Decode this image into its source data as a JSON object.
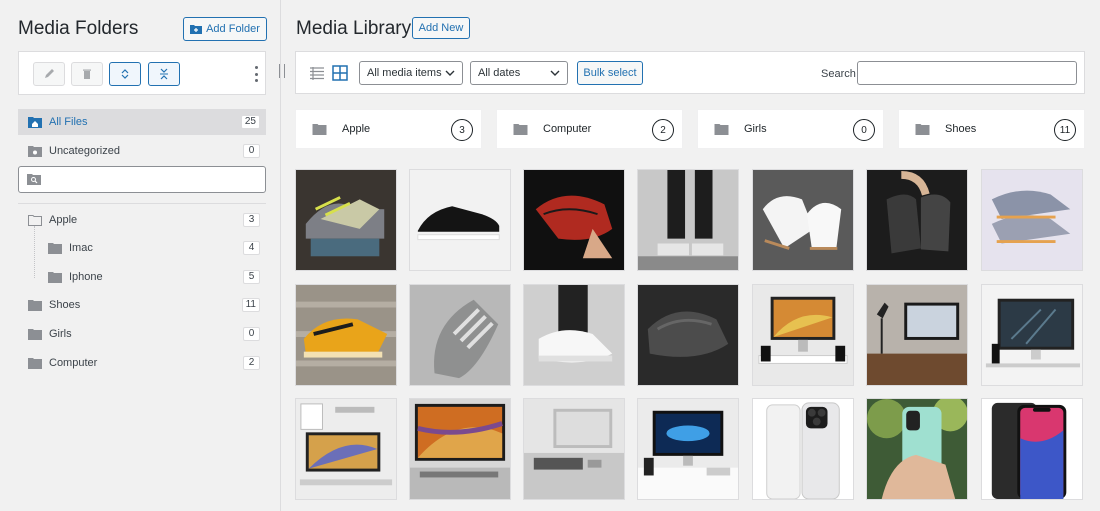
{
  "sidebar": {
    "title": "Media Folders",
    "add_folder_label": "Add Folder",
    "system_folders": [
      {
        "label": "All Files",
        "count": "25"
      },
      {
        "label": "Uncategorized",
        "count": "0"
      }
    ],
    "search": {
      "placeholder": ""
    },
    "tree": [
      {
        "label": "Apple",
        "count": "3"
      },
      {
        "label": "Imac",
        "count": "4"
      },
      {
        "label": "Iphone",
        "count": "5"
      },
      {
        "label": "Shoes",
        "count": "11"
      },
      {
        "label": "Girls",
        "count": "0"
      },
      {
        "label": "Computer",
        "count": "2"
      }
    ]
  },
  "main": {
    "title": "Media Library",
    "add_new_label": "Add New",
    "filters": {
      "media_type": "All media items",
      "dates": "All dates",
      "bulk_label": "Bulk select",
      "search_label": "Search",
      "search_value": ""
    },
    "folder_cards": [
      {
        "name": "Apple",
        "count": "3"
      },
      {
        "name": "Computer",
        "count": "2"
      },
      {
        "name": "Girls",
        "count": "0"
      },
      {
        "name": "Shoes",
        "count": "11"
      }
    ]
  },
  "colors": {
    "accent": "#2271b1",
    "selected_bg": "#dcdcde",
    "folder_icon": "#8c8f94"
  }
}
